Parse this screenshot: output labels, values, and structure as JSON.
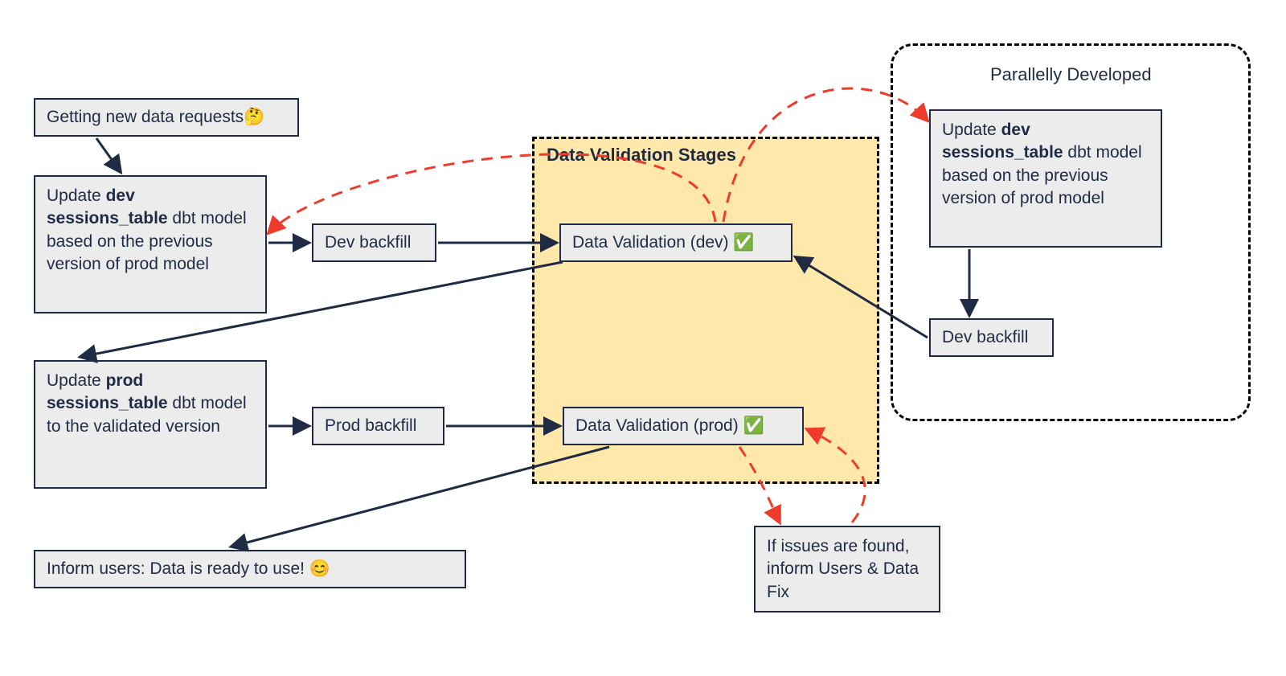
{
  "stage_title": "Data Validation Stages",
  "parallel_title": "Parallelly Developed",
  "nodes": {
    "getting": "Getting new data requests🤔",
    "update_dev_pre": "Update ",
    "update_dev_bold": "dev sessions_table",
    "update_dev_post": " dbt model based on the previous version of prod model",
    "dev_backfill": "Dev backfill",
    "val_dev": "Data Validation (dev) ✅",
    "update_prod_pre": "Update ",
    "update_prod_bold": "prod sessions_table",
    "update_prod_post": " dbt model to the validated version",
    "prod_backfill": "Prod backfill",
    "val_prod": "Data Validation (prod) ✅",
    "inform": "Inform users: Data is ready to use! 😊",
    "issues": "If issues are found, inform Users & Data Fix",
    "p_update_pre": "Update ",
    "p_update_bold": "dev sessions_table",
    "p_update_post": " dbt model based on the previous version of prod model",
    "p_backfill": "Dev backfill"
  }
}
